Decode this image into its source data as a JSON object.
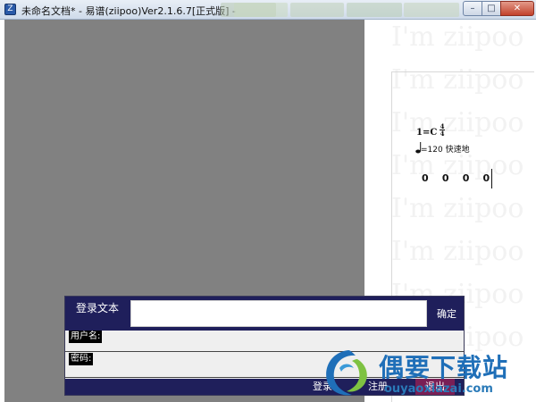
{
  "window": {
    "title": "未命名文档* - 易谱(ziipoo)Ver2.1.6.7[正式版]  -",
    "app_icon_glyph": "Z",
    "controls": {
      "minimize": "–",
      "maximize": "□",
      "close": "✕"
    }
  },
  "score": {
    "watermark": "I'm ziipoo",
    "key_signature": "1=C",
    "time_signature": {
      "top": "4",
      "bottom": "4"
    },
    "tempo": "=120  快速地",
    "notes": [
      "0",
      "0",
      "0",
      "0"
    ]
  },
  "login": {
    "title": "登录文本",
    "confirm": "确定",
    "username_label": "用户名:",
    "password_label": "密码:",
    "login_button": "登录",
    "register_button": "注册",
    "exit_button": "退出"
  },
  "site_logo": {
    "name": "偶要下载站",
    "url": "ouyaoxiazai.com"
  },
  "colors": {
    "dialog_dark": "#1f1f5b",
    "exit_accent": "#7a1f55",
    "logo_blue": "#1f6fb8"
  }
}
